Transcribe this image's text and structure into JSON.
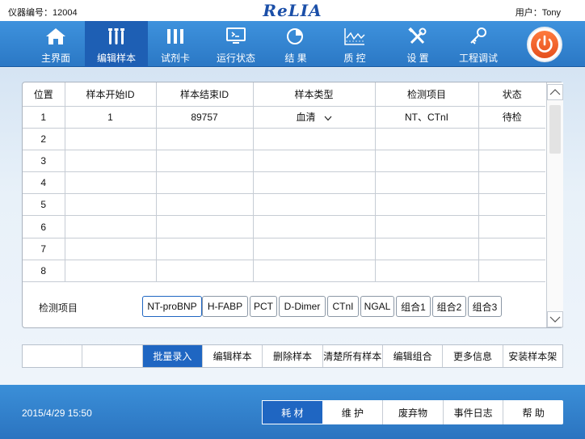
{
  "header": {
    "device_id": "仪器编号：12004",
    "brand": "ReLIA",
    "user": "用户：Tony"
  },
  "nav": {
    "items": [
      {
        "label": "主界面",
        "icon": "home-icon"
      },
      {
        "label": "编辑样本",
        "icon": "sample-tubes-icon",
        "active": true
      },
      {
        "label": "试剂卡",
        "icon": "reagent-card-icon"
      },
      {
        "label": "运行状态",
        "icon": "monitor-icon"
      },
      {
        "label": "结  果",
        "icon": "pie-chart-icon"
      },
      {
        "label": "质  控",
        "icon": "line-chart-icon"
      },
      {
        "label": "设  置",
        "icon": "tools-icon"
      },
      {
        "label": "工程调试",
        "icon": "key-icon"
      }
    ],
    "power_icon": "power-icon"
  },
  "table": {
    "headers": [
      "位置",
      "样本开始ID",
      "样本结束ID",
      "样本类型",
      "检测项目",
      "状态"
    ],
    "rows": [
      {
        "pos": "1",
        "start": "1",
        "end": "89757",
        "type": "血清",
        "items": "NT、CTnI",
        "status": "待检"
      },
      {
        "pos": "2",
        "start": "",
        "end": "",
        "type": "",
        "items": "",
        "status": ""
      },
      {
        "pos": "3",
        "start": "",
        "end": "",
        "type": "",
        "items": "",
        "status": ""
      },
      {
        "pos": "4",
        "start": "",
        "end": "",
        "type": "",
        "items": "",
        "status": ""
      },
      {
        "pos": "5",
        "start": "",
        "end": "",
        "type": "",
        "items": "",
        "status": ""
      },
      {
        "pos": "6",
        "start": "",
        "end": "",
        "type": "",
        "items": "",
        "status": ""
      },
      {
        "pos": "7",
        "start": "",
        "end": "",
        "type": "",
        "items": "",
        "status": ""
      },
      {
        "pos": "8",
        "start": "",
        "end": "",
        "type": "",
        "items": "",
        "status": ""
      }
    ],
    "dropdown_icon": "chevron-down-icon"
  },
  "test_items": {
    "label": "检测项目",
    "chips": [
      "NT-proBNP",
      "H-FABP",
      "PCT",
      "D-Dimer",
      "CTnI",
      "NGAL",
      "组合1",
      "组合2",
      "组合3"
    ],
    "selected": "NT-proBNP"
  },
  "toolbar": {
    "buttons": [
      "",
      "",
      "批量录入",
      "编辑样本",
      "删除样本",
      "清楚所有样本",
      "编辑组合",
      "更多信息",
      "安装样本架"
    ],
    "active": "批量录入"
  },
  "footer": {
    "datetime": "2015/4/29 15:50",
    "buttons": [
      "耗  材",
      "维  护",
      "废弃物",
      "事件日志",
      "帮  助"
    ],
    "active": "耗  材"
  },
  "colors": {
    "nav_bg": "#3488d6",
    "nav_active": "#1e5fb4",
    "accent_blue": "#1f66c2",
    "power_orange": "#e9561f",
    "brand_blue": "#1b4fa8"
  }
}
